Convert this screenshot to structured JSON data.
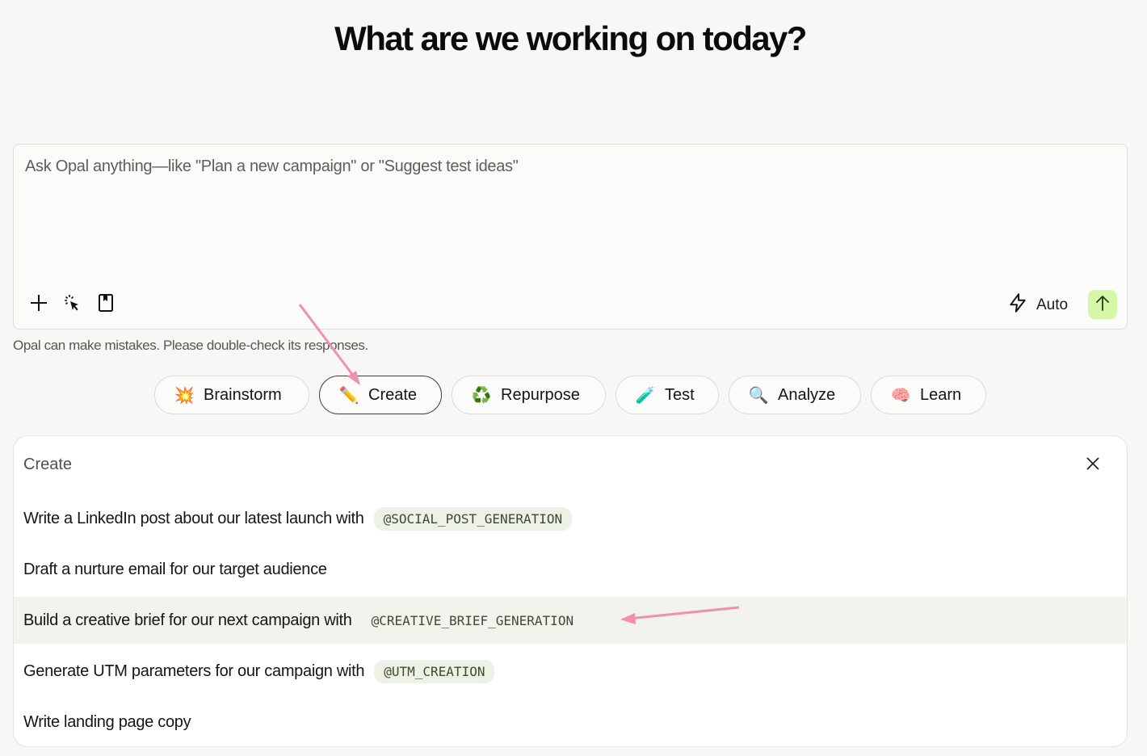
{
  "heading": "What are we working on today?",
  "composer": {
    "placeholder": "Ask Opal anything—like \"Plan a new campaign\" or \"Suggest test ideas\"",
    "value": "",
    "mode_label": "Auto",
    "send_accent": "#d6f7a8",
    "tools": [
      "plus-icon",
      "cursor-select-icon",
      "bookmark-icon"
    ]
  },
  "disclaimer": "Opal can make mistakes. Please double-check its responses.",
  "chips": [
    {
      "label": "Brainstorm",
      "icon": "💥",
      "active": false
    },
    {
      "label": "Create",
      "icon": "✏️",
      "active": true
    },
    {
      "label": "Repurpose",
      "icon": "♻️",
      "active": false
    },
    {
      "label": "Test",
      "icon": "🧪",
      "active": false
    },
    {
      "label": "Analyze",
      "icon": "🔍",
      "active": false
    },
    {
      "label": "Learn",
      "icon": "🧠",
      "active": false
    }
  ],
  "panel": {
    "title": "Create",
    "suggestions": [
      {
        "text": "Write a LinkedIn post about our latest launch with",
        "tag": "@SOCIAL_POST_GENERATION",
        "highlighted": false
      },
      {
        "text": "Draft a nurture email for our target audience",
        "tag": "",
        "highlighted": false
      },
      {
        "text": "Build a creative brief for our next campaign with",
        "tag": "@CREATIVE_BRIEF_GENERATION",
        "highlighted": true
      },
      {
        "text": "Generate UTM parameters for our campaign with",
        "tag": "@UTM_CREATION",
        "highlighted": false
      },
      {
        "text": "Write landing page copy",
        "tag": "",
        "highlighted": false
      }
    ]
  },
  "annotation_color": "#f08fb0"
}
